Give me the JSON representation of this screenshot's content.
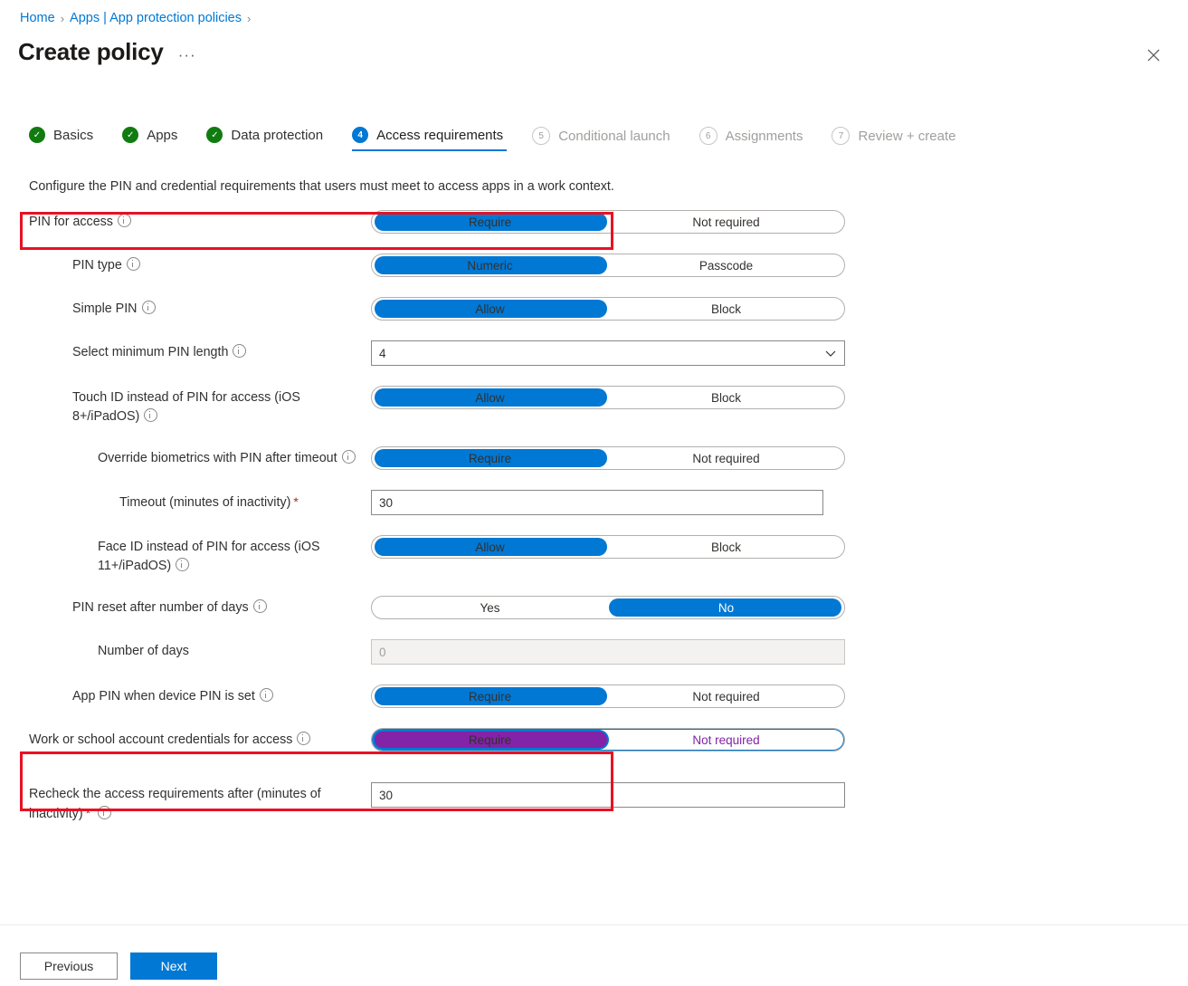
{
  "breadcrumb": {
    "items": [
      {
        "label": "Home",
        "link": true
      },
      {
        "label": "Apps | App protection policies",
        "link": true
      }
    ],
    "separator": "›"
  },
  "header": {
    "title": "Create policy",
    "ellipsis": "···",
    "close_icon": "close-icon"
  },
  "wizard": {
    "steps": [
      {
        "number": "1",
        "label": "Basics",
        "state": "done",
        "mark": "✓"
      },
      {
        "number": "2",
        "label": "Apps",
        "state": "done",
        "mark": "✓"
      },
      {
        "number": "3",
        "label": "Data protection",
        "state": "done",
        "mark": "✓"
      },
      {
        "number": "4",
        "label": "Access requirements",
        "state": "active",
        "mark": "4"
      },
      {
        "number": "5",
        "label": "Conditional launch",
        "state": "todo",
        "mark": "5"
      },
      {
        "number": "6",
        "label": "Assignments",
        "state": "todo",
        "mark": "6"
      },
      {
        "number": "7",
        "label": "Review + create",
        "state": "todo",
        "mark": "7"
      }
    ]
  },
  "description": "Configure the PIN and credential requirements that users must meet to access apps in a work context.",
  "form": {
    "pin_for_access": {
      "label": "PIN for access",
      "option_left": "Require",
      "option_right": "Not required",
      "selected": "Require"
    },
    "pin_type": {
      "label": "PIN type",
      "option_left": "Numeric",
      "option_right": "Passcode",
      "selected": "Numeric"
    },
    "simple_pin": {
      "label": "Simple PIN",
      "option_left": "Allow",
      "option_right": "Block",
      "selected": "Allow"
    },
    "min_pin_length": {
      "label": "Select minimum PIN length",
      "value": "4"
    },
    "touch_id": {
      "label": "Touch ID instead of PIN for access (iOS 8+/iPadOS)",
      "option_left": "Allow",
      "option_right": "Block",
      "selected": "Allow"
    },
    "override_biometrics": {
      "label": "Override biometrics with PIN after timeout",
      "option_left": "Require",
      "option_right": "Not required",
      "selected": "Require"
    },
    "timeout": {
      "label": "Timeout (minutes of inactivity)",
      "required_mark": "*",
      "value": "30"
    },
    "face_id": {
      "label": "Face ID instead of PIN for access (iOS 11+/iPadOS)",
      "option_left": "Allow",
      "option_right": "Block",
      "selected": "Allow"
    },
    "pin_reset_days": {
      "label": "PIN reset after number of days",
      "option_left": "Yes",
      "option_right": "No",
      "selected": "No"
    },
    "number_of_days": {
      "label": "Number of days",
      "value": "0",
      "disabled": true
    },
    "app_pin_device_pin": {
      "label": "App PIN when device PIN is set",
      "option_left": "Require",
      "option_right": "Not required",
      "selected": "Require"
    },
    "work_school_credentials": {
      "label": "Work or school account credentials for access",
      "option_left": "Require",
      "option_right": "Not required",
      "selected": "Require",
      "focused": true
    },
    "recheck_access": {
      "label": "Recheck the access requirements after (minutes of inactivity)",
      "required_mark": "*",
      "value": "30"
    }
  },
  "footer": {
    "previous_label": "Previous",
    "next_label": "Next"
  },
  "colors": {
    "accent_blue": "#0078d4",
    "done_green": "#107c10",
    "annotation_red": "#e81123",
    "focus_purple": "#8223a8",
    "required_red": "#a4262c"
  }
}
